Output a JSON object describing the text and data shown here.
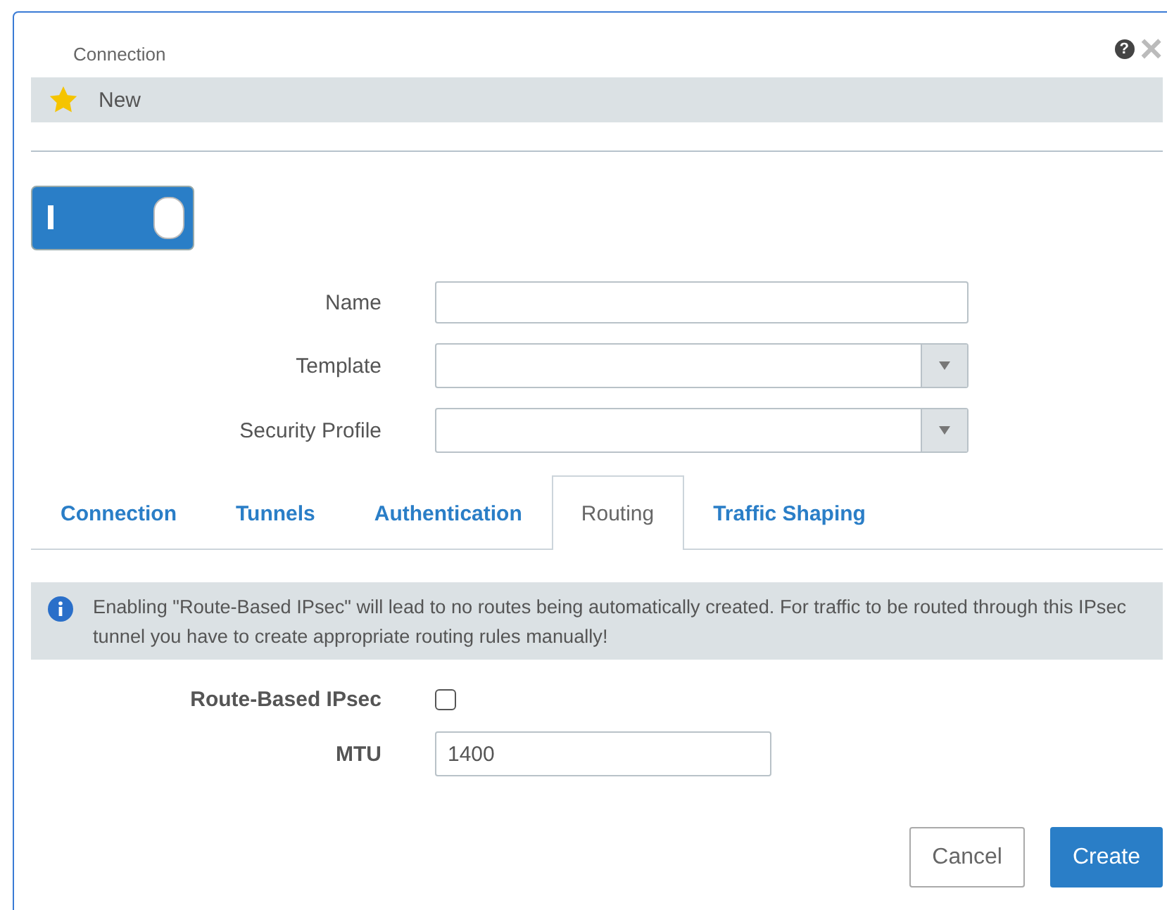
{
  "dialog": {
    "title": "Connection",
    "help": "?",
    "close": "×"
  },
  "header": {
    "label": "New"
  },
  "toggle": {
    "on": true
  },
  "fields": [
    {
      "kind": "text",
      "label": "Name"
    },
    {
      "kind": "select",
      "label": "Template"
    },
    {
      "kind": "select",
      "label": "Security Profile"
    }
  ],
  "tabs": [
    {
      "label": "Connection",
      "selected": false
    },
    {
      "label": "Tunnels",
      "selected": false
    },
    {
      "label": "Authentication",
      "selected": false
    },
    {
      "label": "Routing",
      "selected": true
    },
    {
      "label": "Traffic Shaping",
      "selected": false
    }
  ],
  "info": {
    "text": "Enabling \"Route-Based IPsec\" will lead to no routes being automatically created. For traffic to be routed through this IPsec tunnel you have to create appropriate routing rules manually!"
  },
  "routing": [
    {
      "kind": "checkbox",
      "label": "Route-Based IPsec",
      "checked": false
    },
    {
      "kind": "text",
      "label": "MTU",
      "value": "1400"
    }
  ],
  "buttons": [
    {
      "label": "Cancel",
      "kind": "secondary"
    },
    {
      "label": "Create",
      "kind": "primary"
    }
  ]
}
